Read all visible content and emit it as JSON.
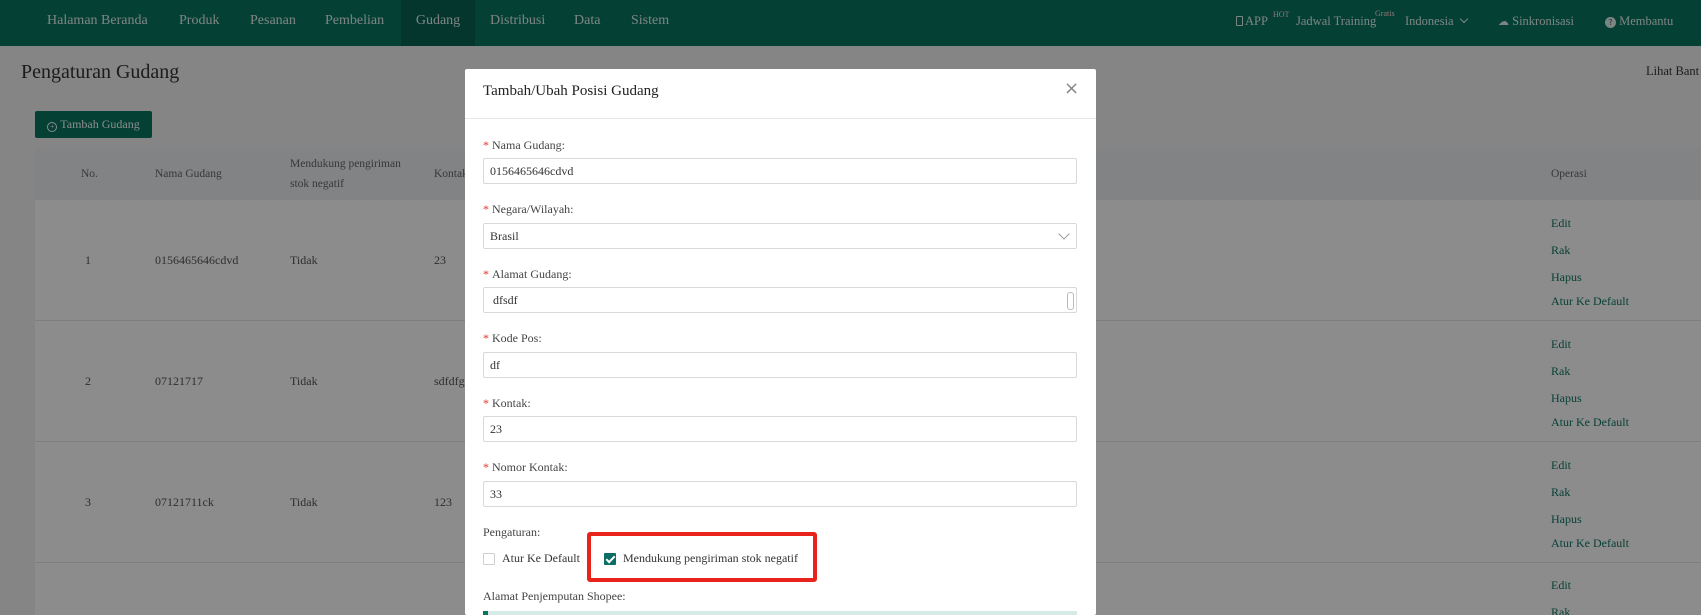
{
  "nav": {
    "items": [
      "Halaman Beranda",
      "Produk",
      "Pesanan",
      "Pembelian",
      "Gudang",
      "Distribusi",
      "Data",
      "Sistem"
    ],
    "active": "Gudang",
    "right": {
      "app_label": "APP",
      "app_badge": "HOT",
      "training_label": "Jadwal Training",
      "training_badge": "Gratis",
      "language_label": "Indonesia",
      "sync_label": "Sinkronisasi",
      "help_label": "Membantu"
    }
  },
  "page": {
    "title": "Pengaturan Gudang",
    "help_link": "Lihat Bant",
    "add_button": "Tambah Gudang"
  },
  "table": {
    "headers": {
      "no": "No.",
      "name": "Nama Gudang",
      "negative_line1": "Mendukung pengiriman",
      "negative_line2": "stok negatif",
      "contact": "Kontak",
      "operations": "Operasi"
    },
    "rows": [
      {
        "no": "1",
        "name": "0156465646cdvd",
        "negative": "Tidak",
        "contact": "23"
      },
      {
        "no": "2",
        "name": "07121717",
        "negative": "Tidak",
        "contact": "sdfdfg"
      },
      {
        "no": "3",
        "name": "07121711ck",
        "negative": "Tidak",
        "contact": "123"
      }
    ],
    "operations": {
      "edit": "Edit",
      "shelf": "Rak",
      "delete": "Hapus",
      "set_default": "Atur Ke Default"
    }
  },
  "modal": {
    "title": "Tambah/Ubah Posisi Gudang",
    "fields": {
      "warehouse_name": {
        "label": "Nama Gudang:",
        "value": "0156465646cdvd"
      },
      "country": {
        "label": "Negara/Wilayah:",
        "value": "Brasil"
      },
      "address": {
        "label": "Alamat Gudang:",
        "value": "dfsdf"
      },
      "postal": {
        "label": "Kode Pos:",
        "value": "df"
      },
      "contact": {
        "label": "Kontak:",
        "value": "23"
      },
      "phone": {
        "label": "Nomor Kontak:",
        "value": "33"
      }
    },
    "settings_label": "Pengaturan:",
    "set_default_label": "Atur Ke Default",
    "set_default_checked": false,
    "negative_stock_label": "Mendukung pengiriman stok negatif",
    "negative_stock_checked": true,
    "shopee_label": "Alamat Penjemputan Shopee:"
  },
  "colors": {
    "nav_bg": "#087560",
    "accent": "#087560",
    "checkbox": "#0c6d66",
    "highlight": "#e8231c",
    "link": "#0f7561"
  }
}
